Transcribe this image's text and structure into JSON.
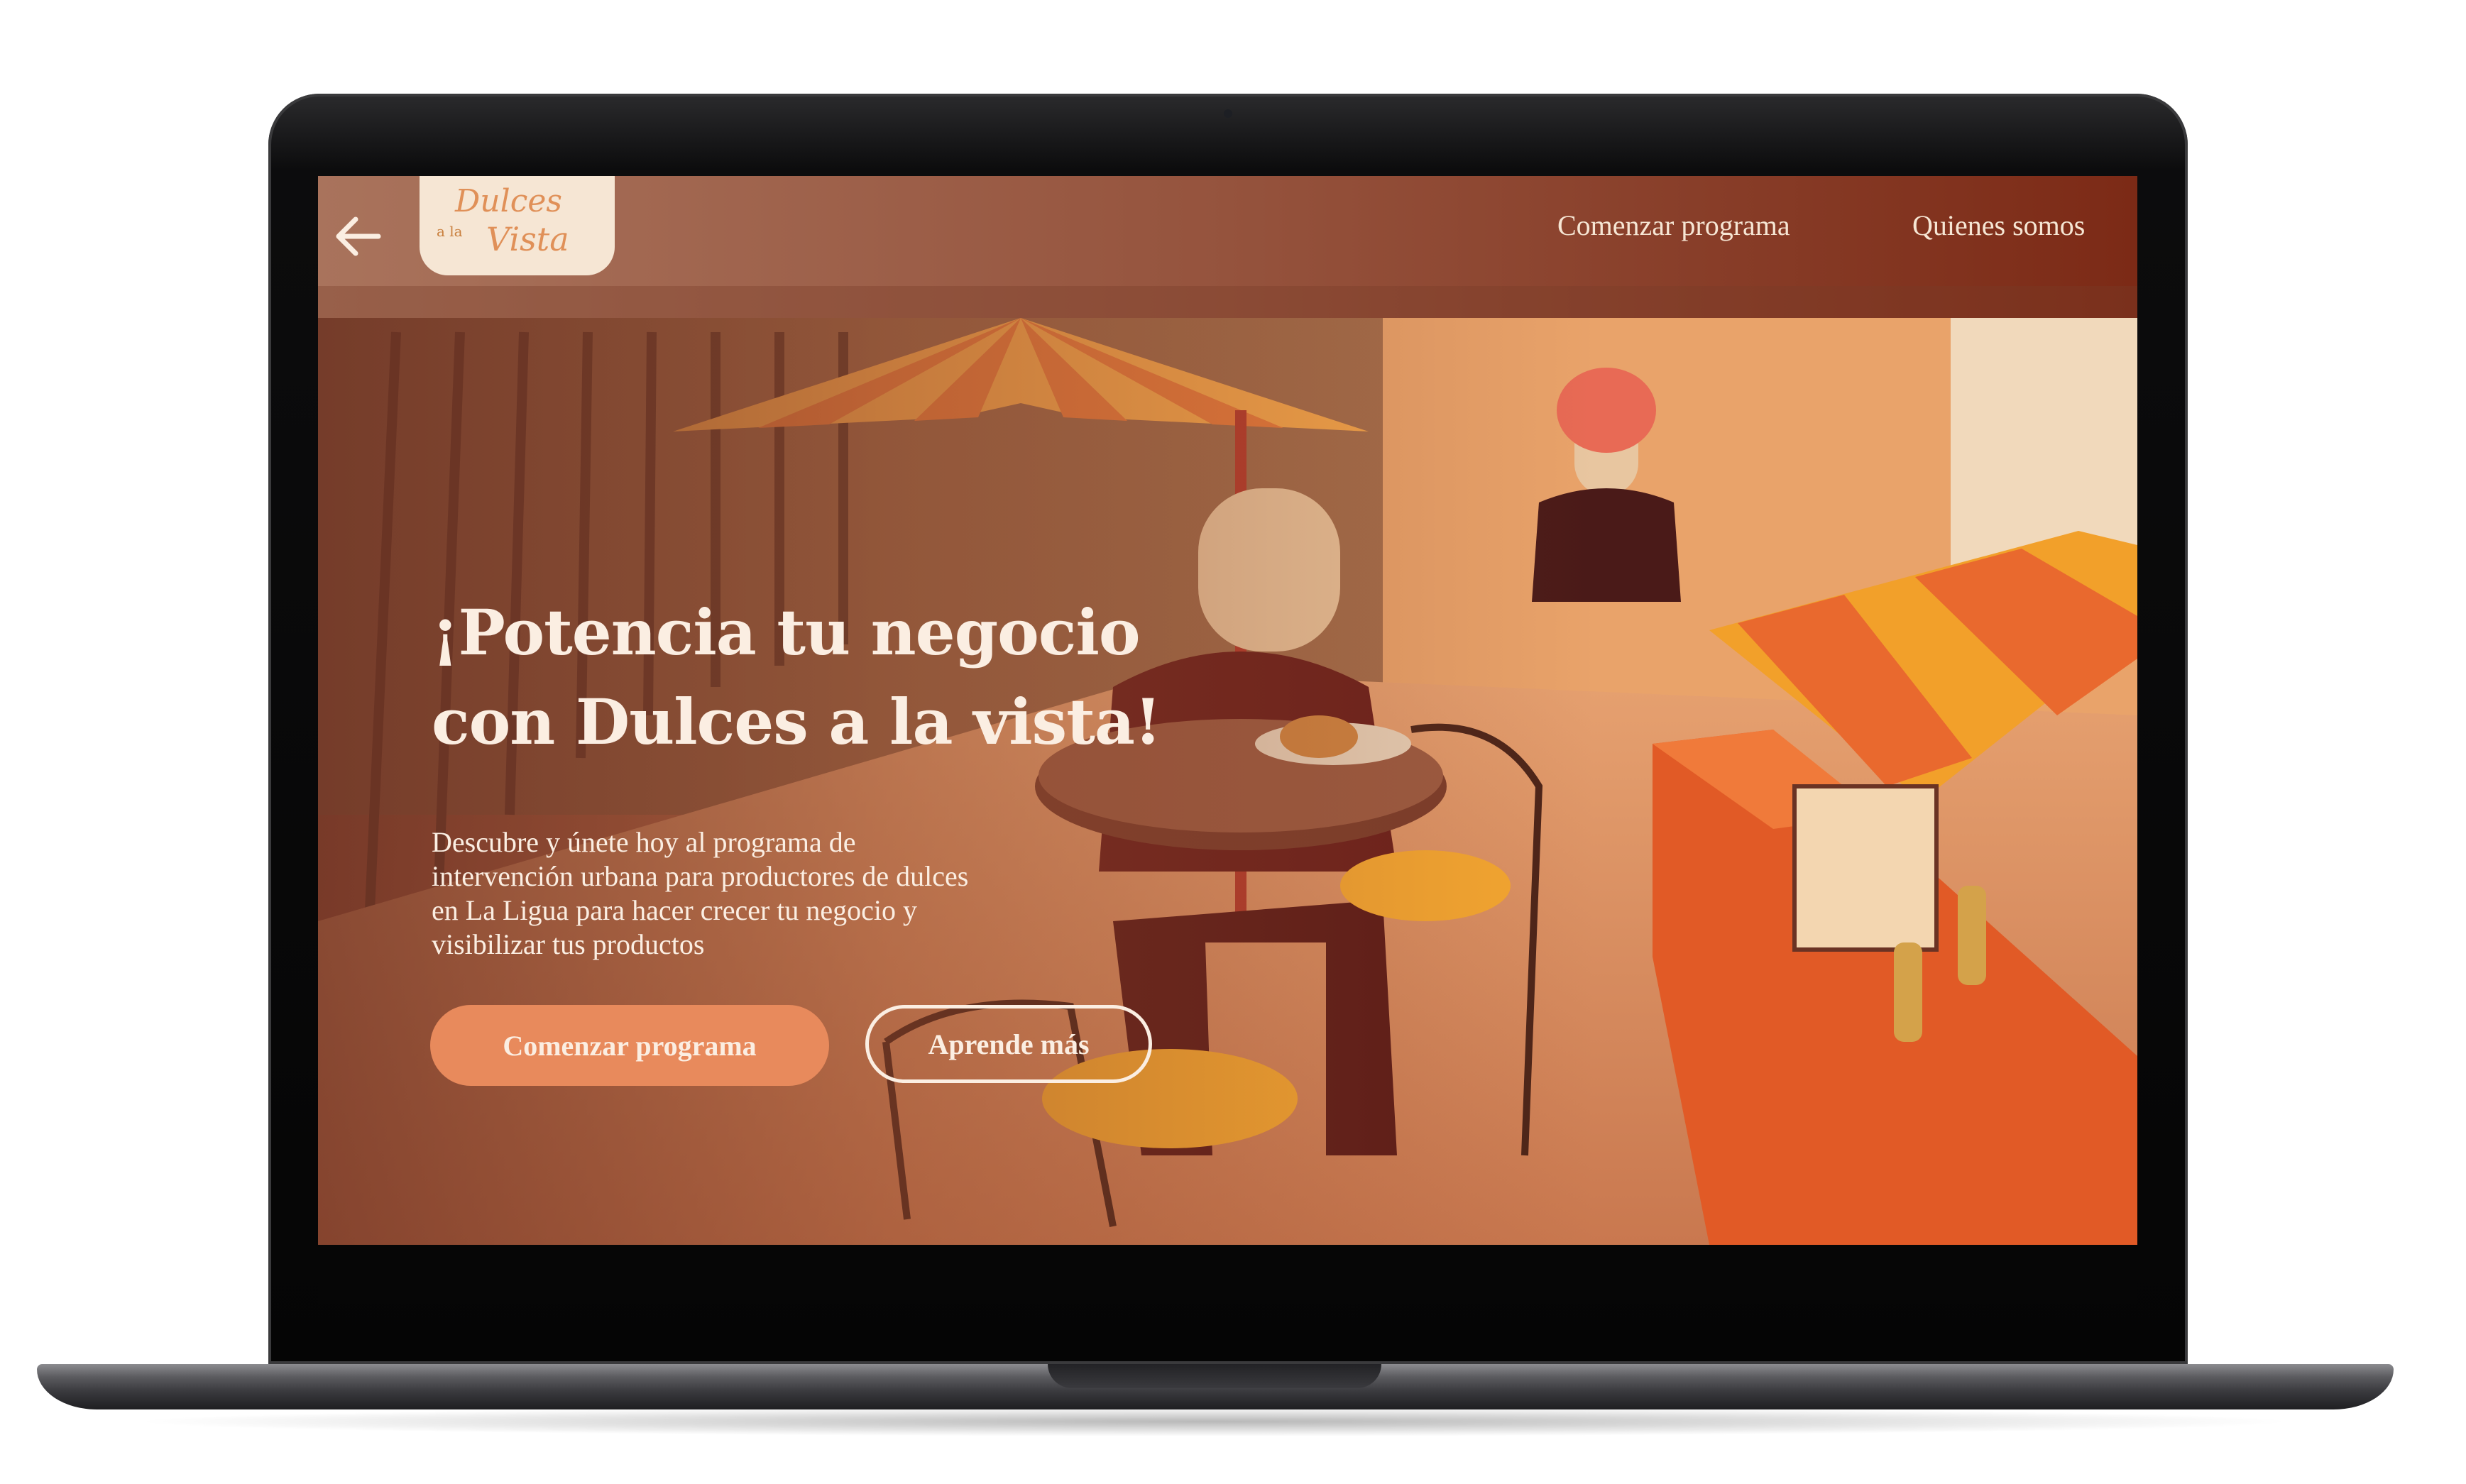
{
  "navbar": {
    "logo": {
      "line1": "Dulces",
      "line2": "a la",
      "line3": "Vista"
    },
    "links": [
      {
        "label": "Comenzar programa"
      },
      {
        "label": "Quienes somos"
      }
    ]
  },
  "hero": {
    "title_line1": "¡Potencia tu negocio",
    "title_line2": "con Dulces a la vista!",
    "description_lines": [
      "Descubre y únete hoy al programa de",
      "intervención urbana para productores de dulces",
      "en La Ligua para hacer crecer tu negocio y",
      "visibilizar tus productos"
    ],
    "primary_button": "Comenzar programa",
    "secondary_button": "Aprende más"
  },
  "icons": {
    "back": "arrow-left-icon"
  },
  "colors": {
    "accent": "#e88a5c",
    "text_light": "#fbeee2",
    "logo_bg": "#f6e6d4",
    "nav_dark": "#7c2a16"
  }
}
